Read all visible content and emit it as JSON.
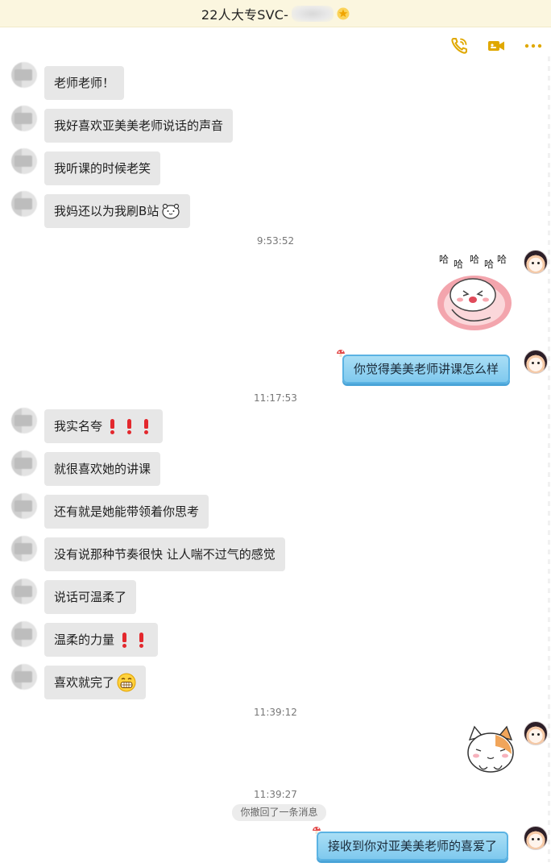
{
  "header": {
    "title": "22人大专SVC-",
    "star_icon": "star-icon",
    "call_icon": "phone-icon",
    "video_icon": "video-icon",
    "more_icon": "more-icon",
    "accent_color": "#e0a800"
  },
  "messages": [
    {
      "side": "left",
      "text": "老师老师！"
    },
    {
      "side": "left",
      "text": "我好喜欢亚美美老师说话的声音"
    },
    {
      "side": "left",
      "text": "我听课的时候老笑"
    },
    {
      "side": "left",
      "text": "我妈还以为我刷B站",
      "emoji": "bear-emoji"
    },
    {
      "type": "time",
      "text": "9:53:52"
    },
    {
      "side": "right",
      "type": "sticker",
      "sticker": "laughing-sticker",
      "sticker_text": "哈哈哈哈哈"
    },
    {
      "side": "right",
      "text": "你觉得美美老师讲课怎么样"
    },
    {
      "type": "time",
      "text": "11:17:53"
    },
    {
      "side": "left",
      "text": "我实名夸",
      "emoji": "exclamation-emoji x3"
    },
    {
      "side": "left",
      "text": "就很喜欢她的讲课"
    },
    {
      "side": "left",
      "text": "还有就是她能带领着你思考"
    },
    {
      "side": "left",
      "text": "没有说那种节奏很快 让人喘不过气的感觉"
    },
    {
      "side": "left",
      "text": "说话可温柔了"
    },
    {
      "side": "left",
      "text": "温柔的力量",
      "emoji": "exclamation-emoji x2"
    },
    {
      "side": "left",
      "text": "喜欢就完了",
      "emoji": "grin-emoji"
    },
    {
      "type": "time",
      "text": "11:39:12"
    },
    {
      "side": "right",
      "type": "sticker",
      "sticker": "cat-sticker"
    },
    {
      "type": "time",
      "text": "11:39:27"
    },
    {
      "type": "notice",
      "text": "你撤回了一条消息"
    },
    {
      "side": "right",
      "text": "接收到你对亚美美老师的喜爱了"
    }
  ]
}
